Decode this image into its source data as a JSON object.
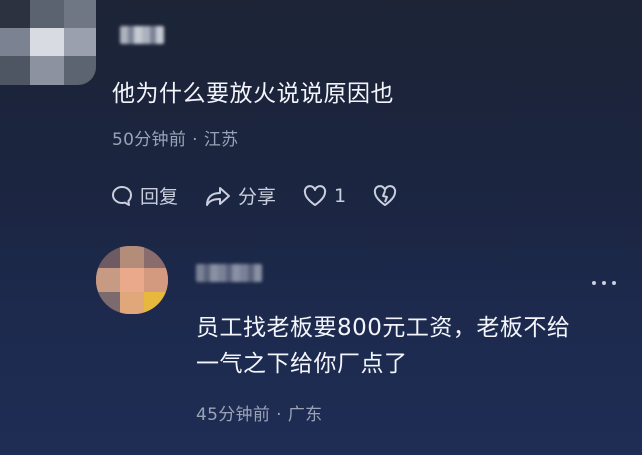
{
  "comments": [
    {
      "text": "他为什么要放火说说原因也",
      "time": "50分钟前",
      "location": "江苏",
      "actions": {
        "reply_label": "回复",
        "share_label": "分享",
        "like_count": "1"
      }
    },
    {
      "text_line1": "员工找老板要800元工资，老板不给",
      "text_line2": "一气之下给你厂点了",
      "time": "45分钟前",
      "location": "广东"
    }
  ],
  "separator": "·",
  "icons": {
    "reply": "chat-bubble-icon",
    "share": "share-arrow-icon",
    "like": "heart-icon",
    "dislike": "broken-heart-icon",
    "more": "more-dots-icon"
  }
}
